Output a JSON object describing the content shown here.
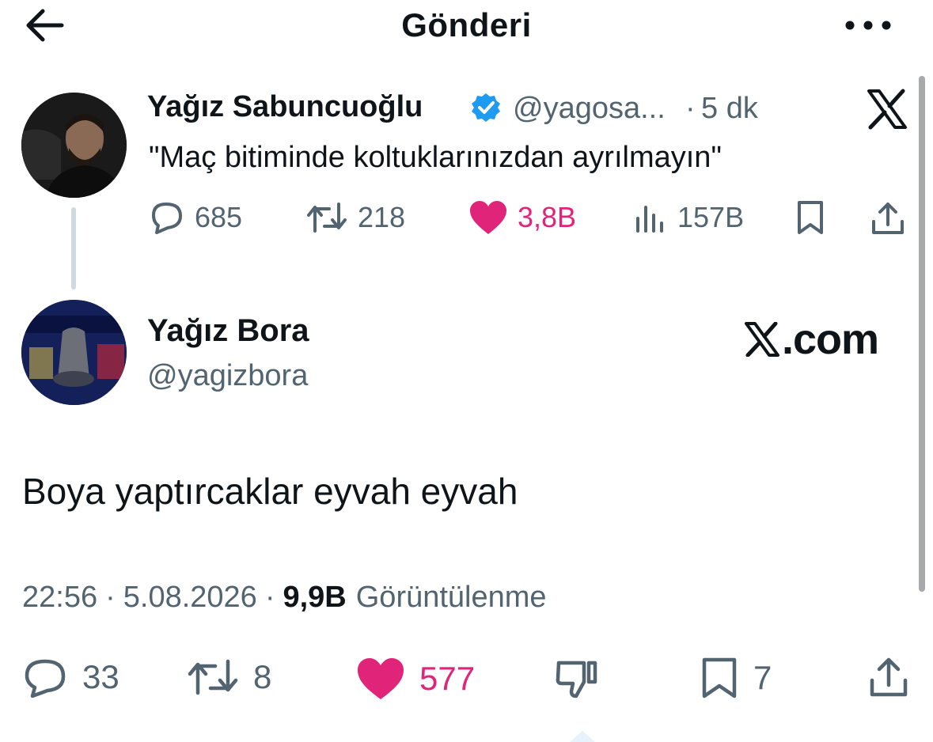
{
  "header": {
    "title": "Gönderi"
  },
  "quoted_tweet": {
    "author_name": "Yağız Sabuncuoğlu",
    "handle": "@yagosa...",
    "separator": "·",
    "time": "5 dk",
    "text": "\"Maç bitiminde koltuklarınızdan ayrılmayın\"",
    "stats": {
      "replies": "685",
      "retweets": "218",
      "likes": "3,8B",
      "views": "157B"
    }
  },
  "tweet": {
    "author_name": "Yağız Bora",
    "handle": "@yagizbora",
    "source_logo_text": ".com",
    "text": "Boya yaptırcaklar eyvah eyvah",
    "time": "22:56",
    "date": "5.08.2026",
    "separator": "·",
    "views_count": "9,9B",
    "views_label": "Görüntülenme",
    "stats": {
      "replies": "33",
      "retweets": "8",
      "likes": "577",
      "bookmarks": "7"
    }
  },
  "colors": {
    "like": "#e0247a",
    "verified": "#1d9bf0",
    "muted_text": "#536471",
    "text": "#0f1419"
  },
  "icons": [
    "back-arrow-icon",
    "more-icon",
    "verified-badge-icon",
    "x-logo-icon",
    "reply-icon",
    "retweet-icon",
    "heart-icon",
    "views-icon",
    "bookmark-icon",
    "share-icon",
    "dislike-icon"
  ]
}
